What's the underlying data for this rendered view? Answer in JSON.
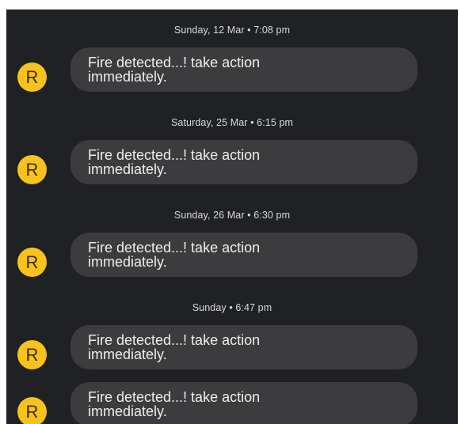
{
  "avatar_letter": "R",
  "colors": {
    "background": "#202124",
    "bubble": "#3c3c3e",
    "avatar": "#f7c21b",
    "text": "#eeeeee",
    "timestamp": "#d9dadc"
  },
  "conversation": {
    "separators": [
      "Sunday, 12 Mar • 7:08 pm",
      "Saturday, 25 Mar • 6:15 pm",
      "Sunday, 26 Mar • 6:30 pm",
      "Sunday • 6:47 pm"
    ],
    "messages": [
      "Fire detected...! take action\nimmediately.",
      "Fire detected...! take action\nimmediately.",
      "Fire detected...! take action\nimmediately.",
      "Fire detected...! take action\nimmediately.",
      "Fire detected...! take action\nimmediately."
    ]
  }
}
